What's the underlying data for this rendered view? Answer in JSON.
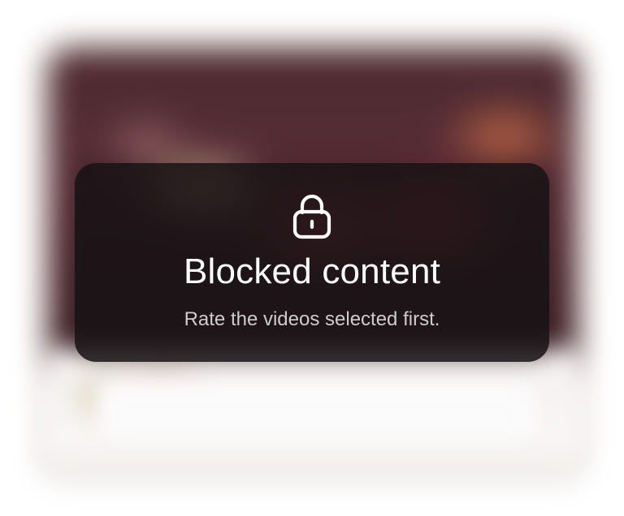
{
  "overlay": {
    "title": "Blocked content",
    "message": "Rate the videos selected first.",
    "icon": "lock-icon"
  },
  "colors": {
    "card_background": "#161214",
    "title_text": "#ffffff",
    "message_text": "#c7c5c6",
    "background_thumbnail_tone": "#5a2d37"
  }
}
